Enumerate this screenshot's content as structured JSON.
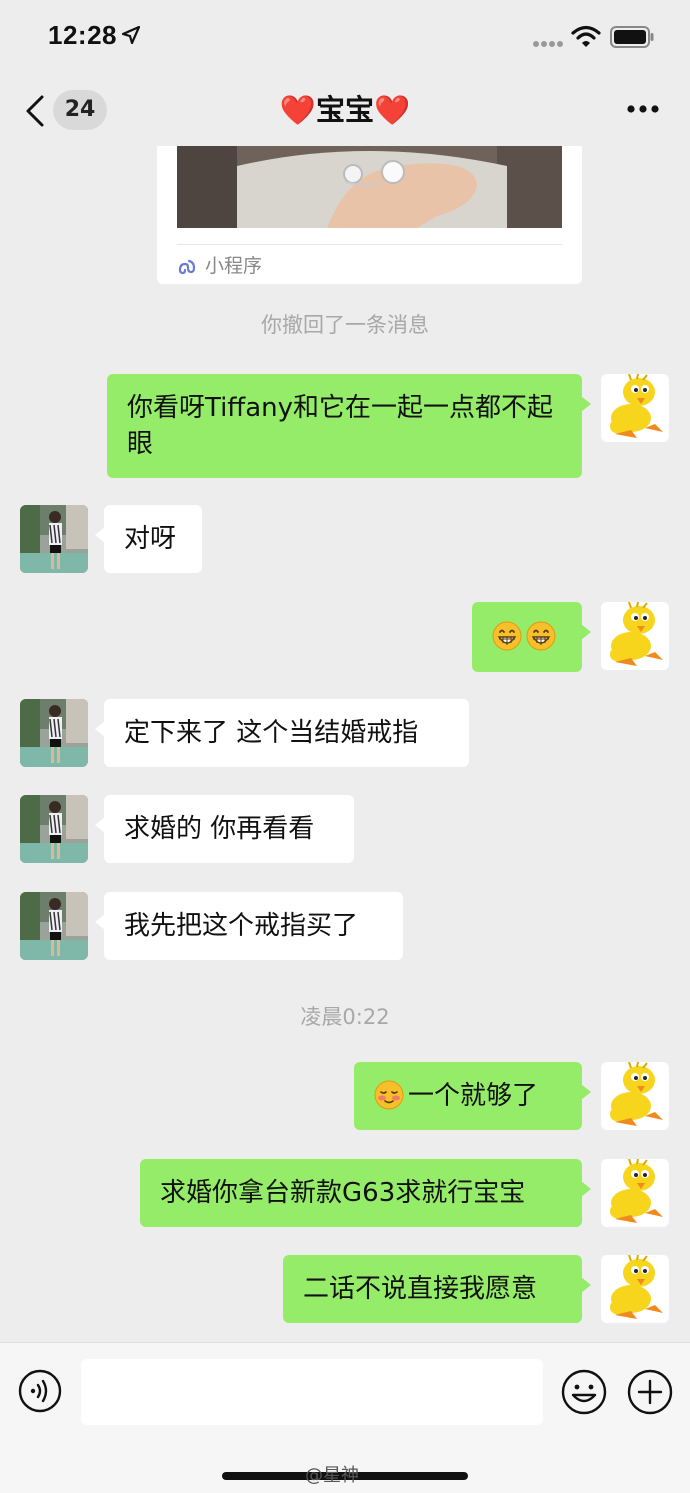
{
  "status_bar": {
    "time": "12:28"
  },
  "nav": {
    "unread_count": "24",
    "title": "❤️宝宝❤️"
  },
  "mini_program_card": {
    "label": "小程序"
  },
  "system_messages": {
    "recalled": "你撤回了一条消息",
    "timestamp": "凌晨0:22"
  },
  "messages": [
    {
      "from": "me",
      "text": "你看呀Tiffany和它在一起一点都不起眼"
    },
    {
      "from": "them",
      "text": "对呀"
    },
    {
      "from": "me",
      "emoji": [
        "grinning-face",
        "grinning-face"
      ]
    },
    {
      "from": "them",
      "text": "定下来了 这个当结婚戒指"
    },
    {
      "from": "them",
      "text": "求婚的 你再看看"
    },
    {
      "from": "them",
      "text": "我先把这个戒指买了"
    },
    {
      "from": "me",
      "emoji_prefix": "smiling-face-with-blush",
      "text": "一个就够了"
    },
    {
      "from": "me",
      "text": "求婚你拿台新款G63求就行宝宝"
    },
    {
      "from": "me",
      "text": "二话不说直接我愿意"
    }
  ],
  "input_bar": {
    "input_value": ""
  },
  "watermark": "@星神",
  "colors": {
    "background": "#ededed",
    "my_bubble": "#95ec69",
    "their_bubble": "#ffffff",
    "system_text": "#a8a8a8"
  },
  "icons": [
    "location-arrow-icon",
    "signal-icon",
    "wifi-icon",
    "battery-icon",
    "back-chevron-icon",
    "more-dots-icon",
    "mini-program-icon",
    "voice-icon",
    "emoji-icon",
    "plus-icon"
  ]
}
